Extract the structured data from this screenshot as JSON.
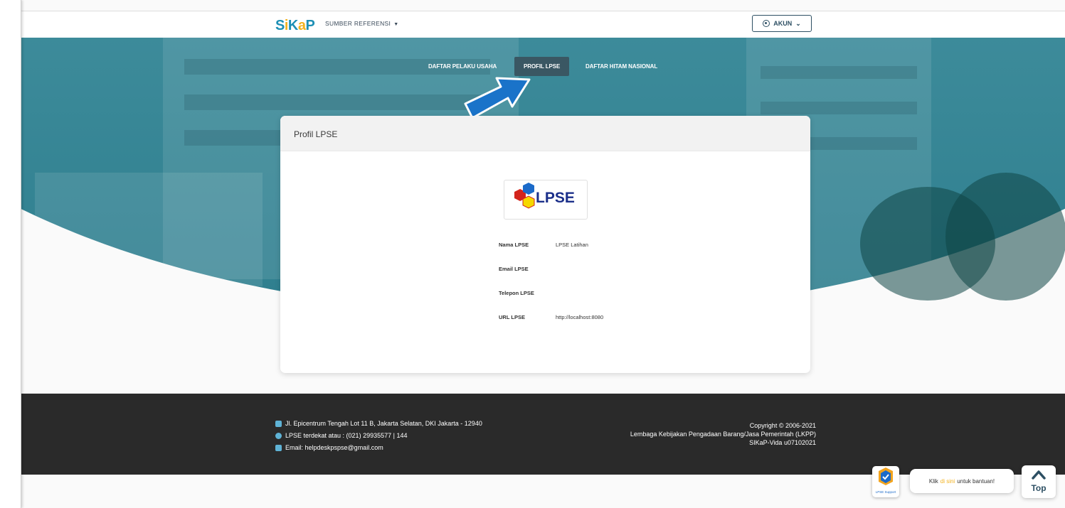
{
  "header": {
    "logo_parts": [
      "S",
      "i",
      "K",
      "a",
      "P"
    ],
    "reference_menu_label": "SUMBER REFERENSI",
    "account_label": "AKUN"
  },
  "tabs": [
    {
      "label": "DAFTAR PELAKU USAHA",
      "active": false
    },
    {
      "label": "PROFIL LPSE",
      "active": true
    },
    {
      "label": "DAFTAR HITAM NASIONAL",
      "active": false
    }
  ],
  "card": {
    "title": "Profil LPSE",
    "logo_text": "LPSE",
    "fields": [
      {
        "label": "Nama LPSE",
        "value": "LPSE Latihan"
      },
      {
        "label": "Email LPSE",
        "value": ""
      },
      {
        "label": "Telepon LPSE",
        "value": ""
      },
      {
        "label": "URL LPSE",
        "value": "http://localhost:8080"
      }
    ]
  },
  "footer": {
    "address": "Jl. Epicentrum Tengah Lot 11 B, Jakarta Selatan, DKI Jakarta - 12940",
    "phone": "LPSE terdekat atau : (021) 29935577 | 144",
    "email": "Email: helpdeskpspse@gmail.com",
    "copyright": "Copyright © 2006-2021",
    "org": "Lembaga Kebijakan Pengadaan Barang/Jasa Pemerintah (LKPP)",
    "version": "SIKaP-Vida u07102021"
  },
  "help": {
    "prefix": "Klik",
    "highlight": "di sini",
    "suffix": "untuk bantuan!",
    "logo_caption": "LPSE Support"
  },
  "top_button_label": "Top",
  "colors": {
    "brand_blue": "#1d8fb5",
    "brand_yellow": "#f2b21f",
    "hero_teal": "#3f8d9c",
    "active_tab": "#3a5763",
    "footer_bg": "#2a2a2a",
    "annotation_arrow": "#1a73c9"
  }
}
